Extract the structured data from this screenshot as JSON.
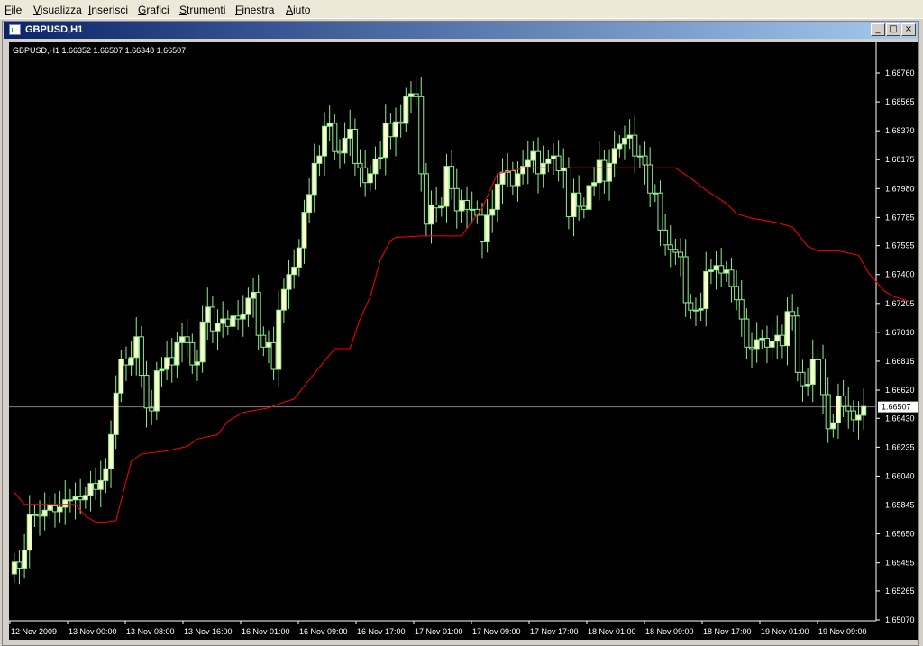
{
  "menu": [
    "File",
    "Visualizza",
    "Inserisci",
    "Grafici",
    "Strumenti",
    "Finestra",
    "Aiuto"
  ],
  "window": {
    "title": "GBPUSD,H1",
    "minimize_label": "_",
    "maximize_label": "□",
    "close_label": "×"
  },
  "colors": {
    "background": "#000000",
    "grid": "#808080",
    "candle": "#90ee90",
    "candle_body_up": "#ffffcc",
    "indicator": "#ff0000",
    "axis_text": "#ffffff"
  },
  "chart_data": {
    "type": "candlestick",
    "symbol": "GBPUSD,H1",
    "ohlc_header": "GBPUSD,H1  1.66352 1.66507 1.66348 1.66507",
    "ylim": [
      1.6507,
      1.6876
    ],
    "y_ticks": [
      "1.68760",
      "1.68565",
      "1.68370",
      "1.68175",
      "1.67980",
      "1.67785",
      "1.67595",
      "1.67400",
      "1.67205",
      "1.67010",
      "1.66815",
      "1.66620",
      "1.66430",
      "1.66235",
      "1.66040",
      "1.65845",
      "1.65650",
      "1.65455",
      "1.65265",
      "1.65070"
    ],
    "current_price": "1.66507",
    "x_labels": [
      "12 Nov 2009",
      "13 Nov 00:00",
      "13 Nov 08:00",
      "13 Nov 16:00",
      "16 Nov 01:00",
      "16 Nov 09:00",
      "16 Nov 17:00",
      "17 Nov 01:00",
      "17 Nov 09:00",
      "17 Nov 17:00",
      "18 Nov 01:00",
      "18 Nov 09:00",
      "18 Nov 17:00",
      "19 Nov 01:00",
      "19 Nov 09:00"
    ],
    "closes": [
      1.6546,
      1.6542,
      1.6554,
      1.6578,
      1.6578,
      1.6577,
      1.6581,
      1.6584,
      1.658,
      1.6583,
      1.6588,
      1.6588,
      1.659,
      1.6588,
      1.6591,
      1.6599,
      1.6595,
      1.6601,
      1.6609,
      1.6632,
      1.666,
      1.6683,
      1.6679,
      1.6684,
      1.6698,
      1.6672,
      1.665,
      1.6648,
      1.6675,
      1.6676,
      1.6684,
      1.6679,
      1.6694,
      1.6698,
      1.6694,
      1.6679,
      1.6681,
      1.6708,
      1.6718,
      1.6702,
      1.6707,
      1.671,
      1.6705,
      1.6712,
      1.671,
      1.6713,
      1.6724,
      1.6728,
      1.6699,
      1.6691,
      1.6694,
      1.6676,
      1.6716,
      1.673,
      1.674,
      1.6745,
      1.6758,
      1.6782,
      1.6794,
      1.6815,
      1.682,
      1.684,
      1.6842,
      1.6823,
      1.6822,
      1.6832,
      1.6838,
      1.6815,
      1.6812,
      1.6802,
      1.6808,
      1.6818,
      1.6819,
      1.6842,
      1.6833,
      1.6843,
      1.6842,
      1.686,
      1.6862,
      1.686,
      1.6808,
      1.6774,
      1.6787,
      1.6785,
      1.6786,
      1.6813,
      1.6798,
      1.6783,
      1.679,
      1.6784,
      1.6784,
      1.678,
      1.6762,
      1.678,
      1.6784,
      1.6801,
      1.6809,
      1.681,
      1.68,
      1.6808,
      1.6813,
      1.6817,
      1.6823,
      1.6808,
      1.6815,
      1.6818,
      1.682,
      1.681,
      1.6812,
      1.6779,
      1.6795,
      1.6786,
      1.6784,
      1.68,
      1.6802,
      1.6817,
      1.6803,
      1.6815,
      1.6825,
      1.6828,
      1.6832,
      1.6834,
      1.682,
      1.682,
      1.6814,
      1.6795,
      1.6795,
      1.677,
      1.676,
      1.6757,
      1.6755,
      1.6752,
      1.6721,
      1.6716,
      1.6716,
      1.6717,
      1.6742,
      1.6743,
      1.6746,
      1.6741,
      1.6743,
      1.6732,
      1.6723,
      1.671,
      1.6691,
      1.669,
      1.6696,
      1.6697,
      1.6691,
      1.6695,
      1.6699,
      1.6692,
      1.6715,
      1.6712,
      1.6674,
      1.6665,
      1.6666,
      1.6683,
      1.6683,
      1.6659,
      1.6636,
      1.664,
      1.6658,
      1.6651,
      1.6648,
      1.6642,
      1.6645,
      1.6651
    ],
    "indicator_series": {
      "color": "#ff0000",
      "points": [
        [
          0,
          1.6593
        ],
        [
          2,
          1.6585
        ],
        [
          12,
          1.6585
        ],
        [
          14,
          1.6577
        ],
        [
          16,
          1.6573
        ],
        [
          18,
          1.6573
        ],
        [
          20,
          1.6574
        ],
        [
          23,
          1.6614
        ],
        [
          25,
          1.6619
        ],
        [
          30,
          1.6621
        ],
        [
          34,
          1.6624
        ],
        [
          36,
          1.6629
        ],
        [
          40,
          1.6632
        ],
        [
          42,
          1.6641
        ],
        [
          45,
          1.6647
        ],
        [
          50,
          1.665
        ],
        [
          53,
          1.6654
        ],
        [
          55,
          1.6656
        ],
        [
          58,
          1.6669
        ],
        [
          63,
          1.669
        ],
        [
          66,
          1.669
        ],
        [
          68,
          1.671
        ],
        [
          70,
          1.6725
        ],
        [
          72,
          1.675
        ],
        [
          74,
          1.6763
        ],
        [
          75,
          1.6765
        ],
        [
          80,
          1.6766
        ],
        [
          85,
          1.6766
        ],
        [
          87,
          1.6766
        ],
        [
          88,
          1.6766
        ],
        [
          90,
          1.6776
        ],
        [
          92,
          1.6785
        ],
        [
          95,
          1.6808
        ],
        [
          100,
          1.6812
        ],
        [
          110,
          1.6812
        ],
        [
          120,
          1.6812
        ],
        [
          130,
          1.6812
        ],
        [
          133,
          1.6805
        ],
        [
          136,
          1.6797
        ],
        [
          140,
          1.6788
        ],
        [
          142,
          1.6781
        ],
        [
          145,
          1.6778
        ],
        [
          150,
          1.6775
        ],
        [
          153,
          1.6772
        ],
        [
          156,
          1.6759
        ],
        [
          158,
          1.6756
        ],
        [
          162,
          1.6756
        ],
        [
          166,
          1.6753
        ],
        [
          168,
          1.6741
        ],
        [
          171,
          1.6729
        ],
        [
          173,
          1.6725
        ],
        [
          176,
          1.6722
        ]
      ]
    }
  }
}
